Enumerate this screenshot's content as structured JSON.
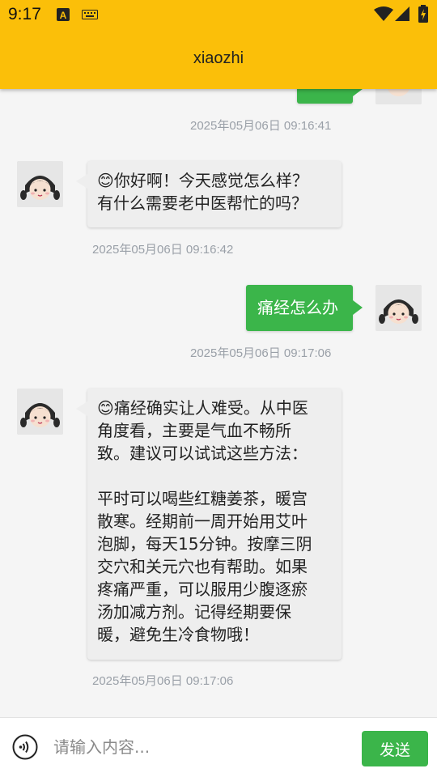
{
  "status_bar": {
    "time": "9:17",
    "icons": [
      "a-badge-icon",
      "keyboard-icon",
      "wifi-icon",
      "signal-icon",
      "battery-charging-icon"
    ]
  },
  "app_bar": {
    "title": "xiaozhi"
  },
  "messages": [
    {
      "sender": "user",
      "text": "",
      "timestamp": "2025年05月06日 09:16:41"
    },
    {
      "sender": "bot",
      "text": "😊你好啊！今天感觉怎么样？\n有什么需要老中医帮忙的吗？",
      "timestamp": "2025年05月06日 09:16:42"
    },
    {
      "sender": "user",
      "text": "痛经怎么办",
      "timestamp": "2025年05月06日 09:17:06"
    },
    {
      "sender": "bot",
      "text": "😊痛经确实让人难受。从中医\n角度看，主要是气血不畅所\n致。建议可以试试这些方法：\n\n平时可以喝些红糖姜茶，暖宫\n散寒。经期前一周开始用艾叶\n泡脚，每天15分钟。按摩三阴\n交穴和关元穴也有帮助。如果\n疼痛严重，可以服用少腹逐瘀\n汤加减方剂。记得经期要保\n暖，避免生冷食物哦！",
      "timestamp": "2025年05月06日 09:17:06"
    }
  ],
  "input_bar": {
    "placeholder": "请输入内容...",
    "send_label": "发送",
    "voice_icon": "voice-icon"
  },
  "colors": {
    "app_bar": "#fbbf09",
    "user_bubble": "#3bb54a",
    "bot_bubble": "#eeeeee",
    "timestamp": "#9aa0a8",
    "background": "#f5f5f5"
  }
}
